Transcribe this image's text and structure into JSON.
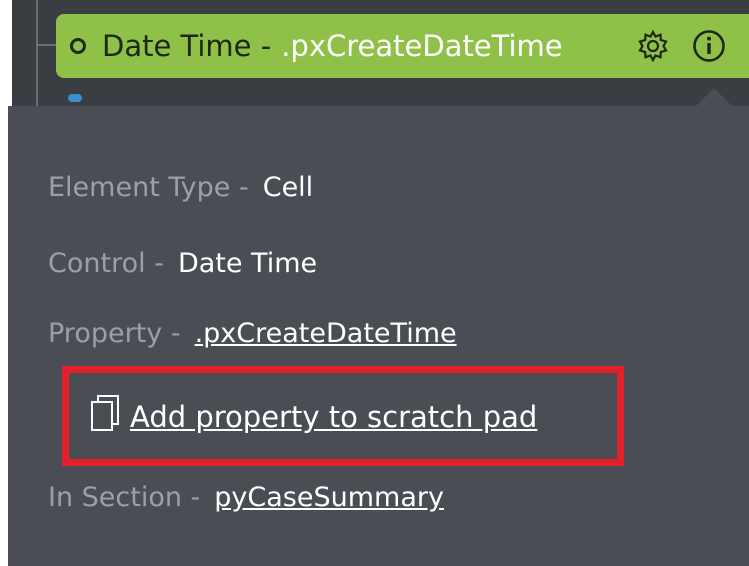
{
  "pill": {
    "title": "Date Time - ",
    "property": ".pxCreateDateTime",
    "status_icon": "circle-icon",
    "settings_icon": "gear-icon",
    "info_icon": "info-icon"
  },
  "details": {
    "element_type_label": "Element Type - ",
    "element_type_value": "Cell",
    "control_label": "Control - ",
    "control_value": "Date Time",
    "property_label": "Property - ",
    "property_value": ".pxCreateDateTime",
    "scratch_pad_link": "Add property to scratch pad ",
    "scratch_pad_icon": "document-icon",
    "section_label": "In Section - ",
    "section_value": "pyCaseSummary"
  },
  "colors": {
    "pill_background": "#8fc047",
    "panel_background": "#4a4e54",
    "highlight_border": "#e2202b",
    "label_text": "#9aa0a6"
  }
}
